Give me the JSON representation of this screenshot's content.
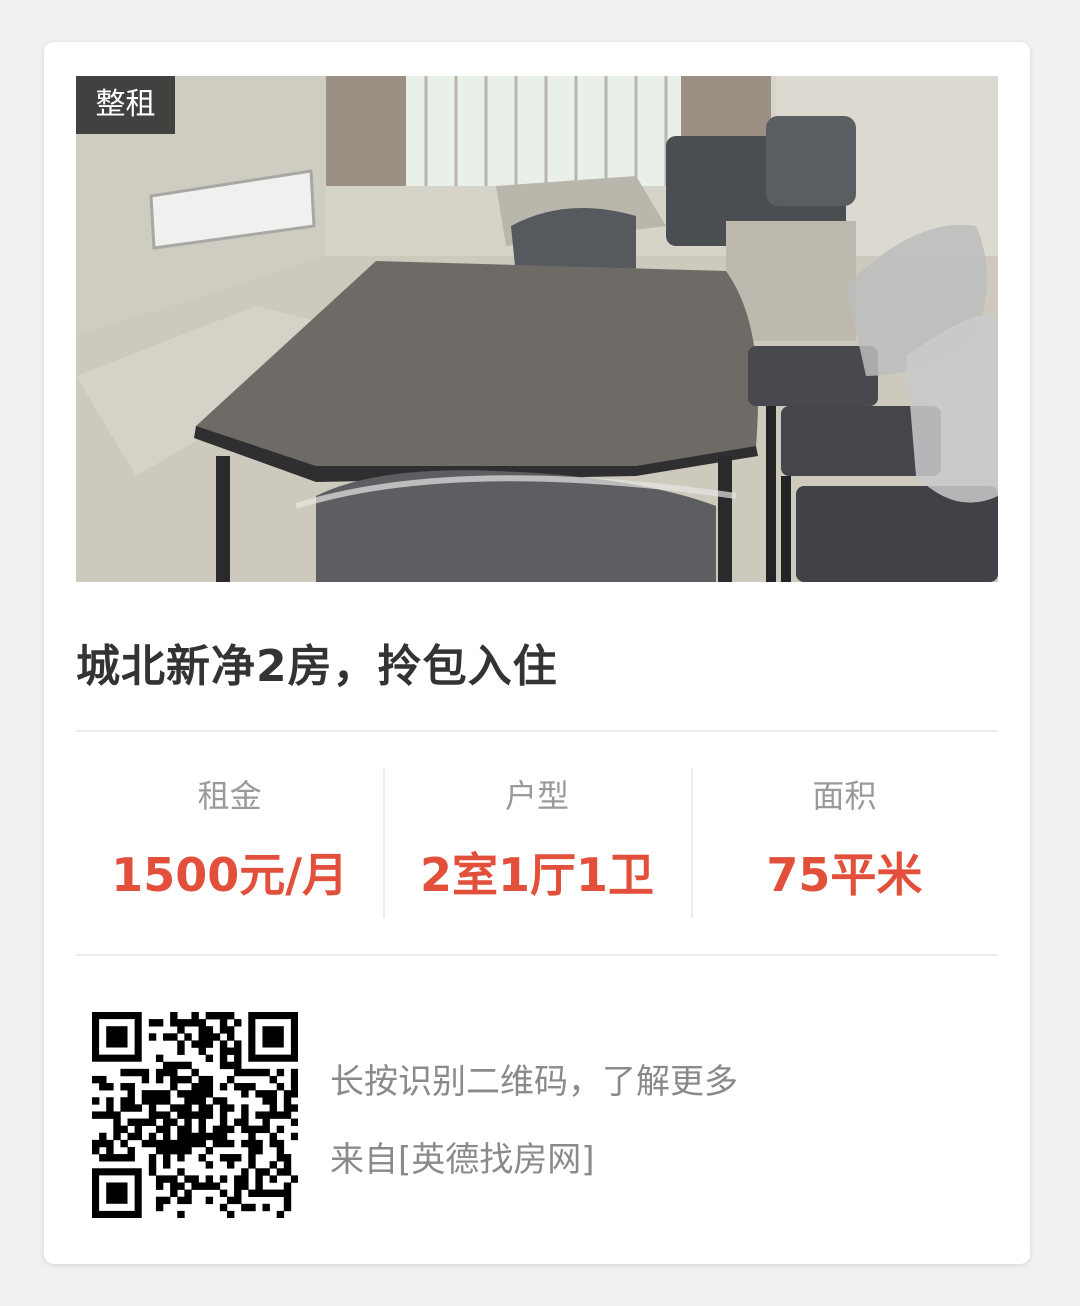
{
  "listing": {
    "tag": "整租",
    "title": "城北新净2房，拎包入住",
    "photo_description": "furnished-apartment-photo"
  },
  "stats": [
    {
      "label": "租金",
      "value": "1500元/月"
    },
    {
      "label": "户型",
      "value": "2室1厅1卫"
    },
    {
      "label": "面积",
      "value": "75平米"
    }
  ],
  "footer": {
    "qr_hint": "长按识别二维码，了解更多",
    "source": "来自[英德找房网]"
  },
  "colors": {
    "accent": "#e2503c",
    "label_gray": "#9a9a9a",
    "title_dark": "#333333",
    "tag_bg": "#282828"
  }
}
